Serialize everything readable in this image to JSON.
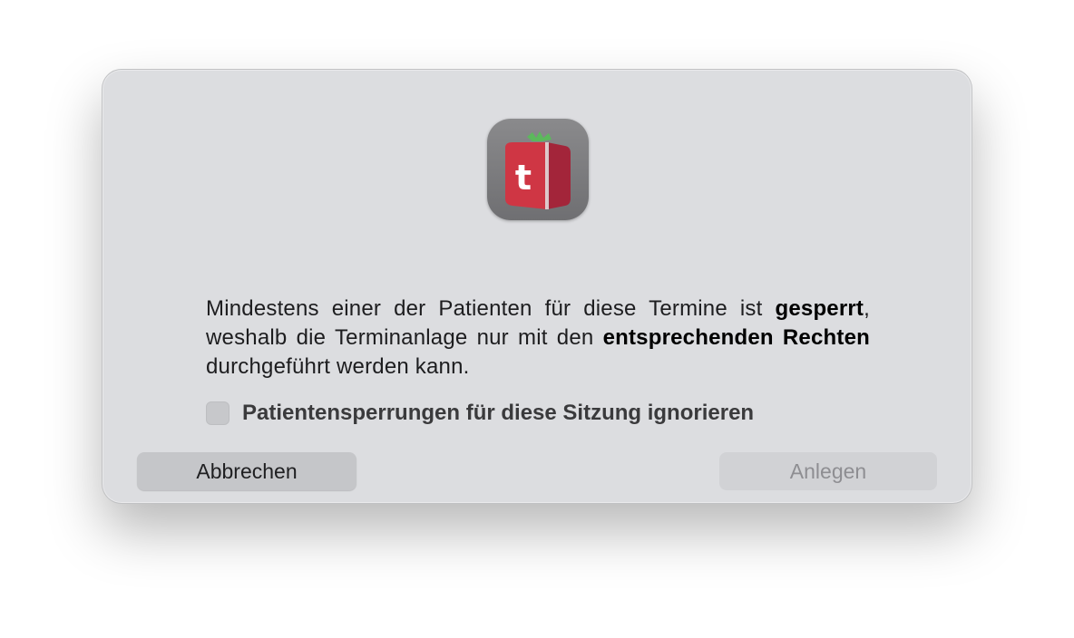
{
  "dialog": {
    "icon": "tomedo-app-icon",
    "message": {
      "part1": "Mindestens einer der Patienten für diese Termine ist ",
      "bold1": "gesperrt",
      "part2": ", weshalb die Terminanlage nur mit den ",
      "bold2": "entsprechenden Rechten",
      "part3": " durchgeführt werden kann."
    },
    "checkbox": {
      "label": "Patientensperrungen für diese Sitzung ignorieren",
      "checked": false
    },
    "buttons": {
      "cancel_label": "Abbrechen",
      "create_label": "Anlegen"
    },
    "icon_letter": "t"
  },
  "colors": {
    "dialog_bg": "#dcdde0",
    "icon_red": "#c8323e",
    "icon_dark_red": "#9e2032",
    "icon_leaf": "#4caf50"
  }
}
